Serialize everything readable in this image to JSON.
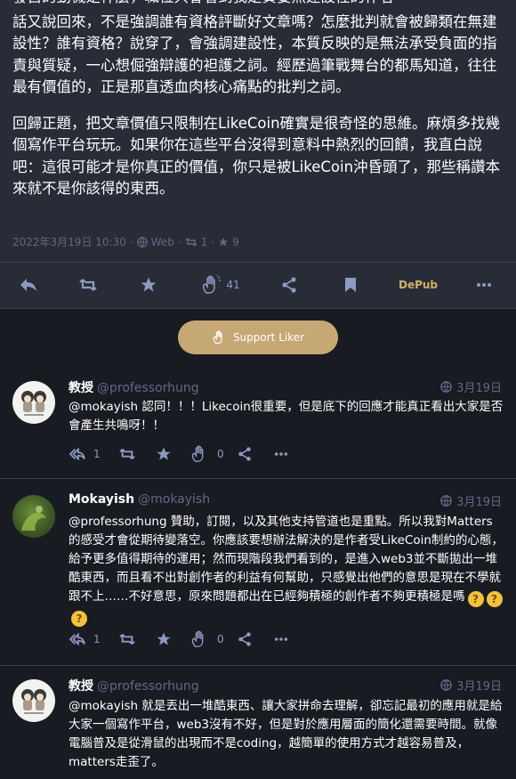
{
  "post": {
    "paragraphs": [
      "發自的動機是什麼，職位只會看到我是貨要無建設性的作者",
      "話又說回來，不是強調誰有資格評斷好文章嗎？怎麼批判就會被歸類在無建設性？誰有資格？說穿了，會強調建設性，本質反映的是無法承受負面的指責與質疑，一心想倔強辯護的袒護之詞。經歷過筆戰舞台的都馬知道，往往最有價值的，正是那直透血肉核心痛點的批判之詞。",
      "回歸正題，把文章價值只限制在LikeCoin確實是很奇怪的思維。麻煩多找幾個寫作平台玩玩。如果你在這些平台沒得到意料中熱烈的回饋，我直白說吧：這很可能才是你真正的價值，你只是被LikeCoin沖昏頭了，那些稱讚本來就不是你該得的東西。"
    ],
    "meta": {
      "date": "2022年3月19日 10:30",
      "sep1": "·",
      "globe_icon": "globe-icon",
      "visibility": "Web",
      "sep2": "·",
      "boosts": "1",
      "sep3": "·",
      "favs": "9"
    },
    "actions": {
      "likes_count": "41",
      "depub_label": "DePub"
    }
  },
  "support": {
    "label": "Support Liker"
  },
  "replies": [
    {
      "name": "教授",
      "handle": "@professorhung",
      "time": "3月19日",
      "text": "@mokayish 認同！！！Likecoin很重要，但是底下的回應才能真正看出大家是否會產生共鳴呀！！",
      "reply_count": "1",
      "likes_count": "0"
    },
    {
      "name": "Mokayish",
      "handle": "@mokayish",
      "time": "3月19日",
      "text": "@professorhung 贊助，訂閱，以及其他支持管道也是重點。所以我對Matters的感受才會從期待變落空。你應該要想辦法解決的是作者受LikeCoin制約的心態，給予更多值得期待的運用；然而現階段我們看到的，是進入web3並不斷拋出一堆酷東西，而且看不出對創作者的利益有何幫助，只感覺出他們的意思是現在不學就跟不上……不好意思，原來問題都出在已經夠積極的創作者不夠更積極是嗎",
      "reply_count": "1",
      "likes_count": "0"
    },
    {
      "name": "教授",
      "handle": "@professorhung",
      "time": "3月19日",
      "text": "@mokayish 就是丟出一堆酷東西、讓大家拼命去理解，卻忘記最初的應用就是給大家一個寫作平台，web3沒有不好，但是對於應用層面的簡化還需要時間。就像電腦普及是從滑鼠的出現而不是coding，越簡單的使用方式才越容易普及，matters走歪了。"
    }
  ],
  "colors": {
    "background": "#191b22",
    "card": "#282c37",
    "icon": "#8d9ac2",
    "muted": "#606984",
    "accent_gold": "#c6a874",
    "depub": "#d4b06a"
  }
}
